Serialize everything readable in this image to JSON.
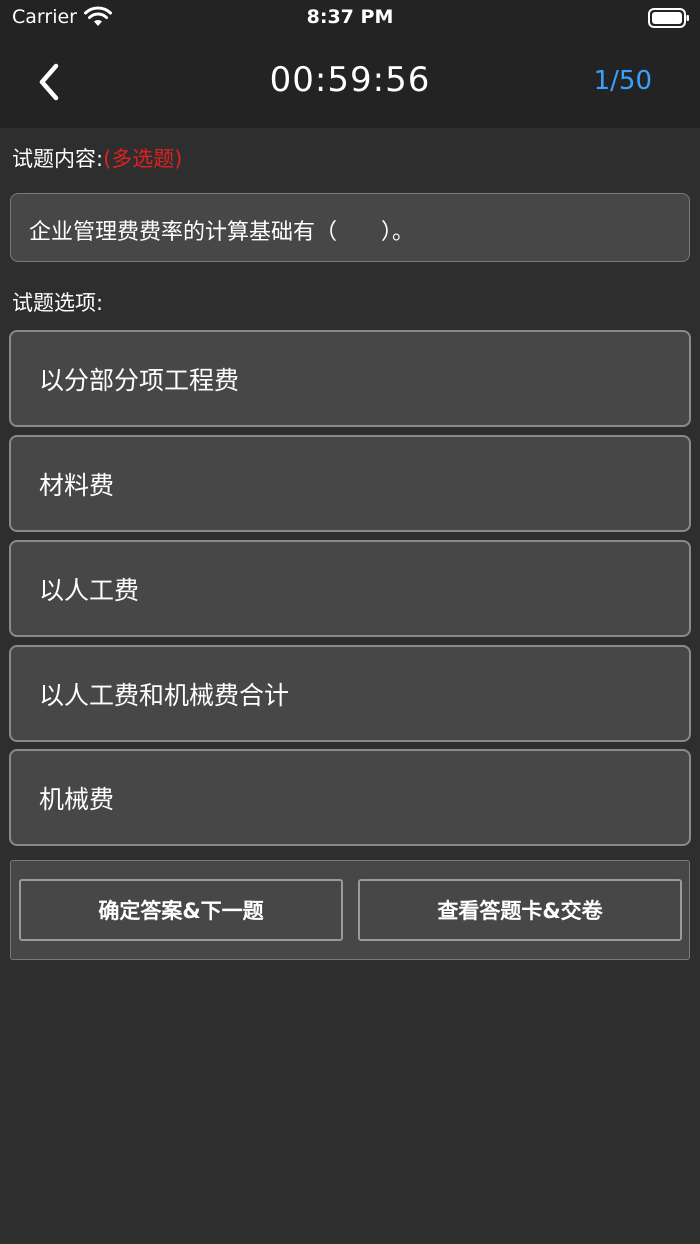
{
  "status_bar": {
    "carrier": "Carrier",
    "time": "8:37 PM"
  },
  "nav": {
    "timer": "00:59:56",
    "counter": "1/50",
    "counter_color": "#3aa1ff"
  },
  "question": {
    "label": "试题内容:",
    "type": "(多选题)",
    "type_color": "#e02020",
    "text": "企业管理费费率的计算基础有（　　）。"
  },
  "options": {
    "label": "试题选项:",
    "items": [
      "以分部分项工程费",
      "材料费",
      "以人工费",
      "以人工费和机械费合计",
      "机械费"
    ]
  },
  "actions": {
    "confirm_label": "确定答案&下一题",
    "submit_label": "查看答题卡&交卷"
  }
}
